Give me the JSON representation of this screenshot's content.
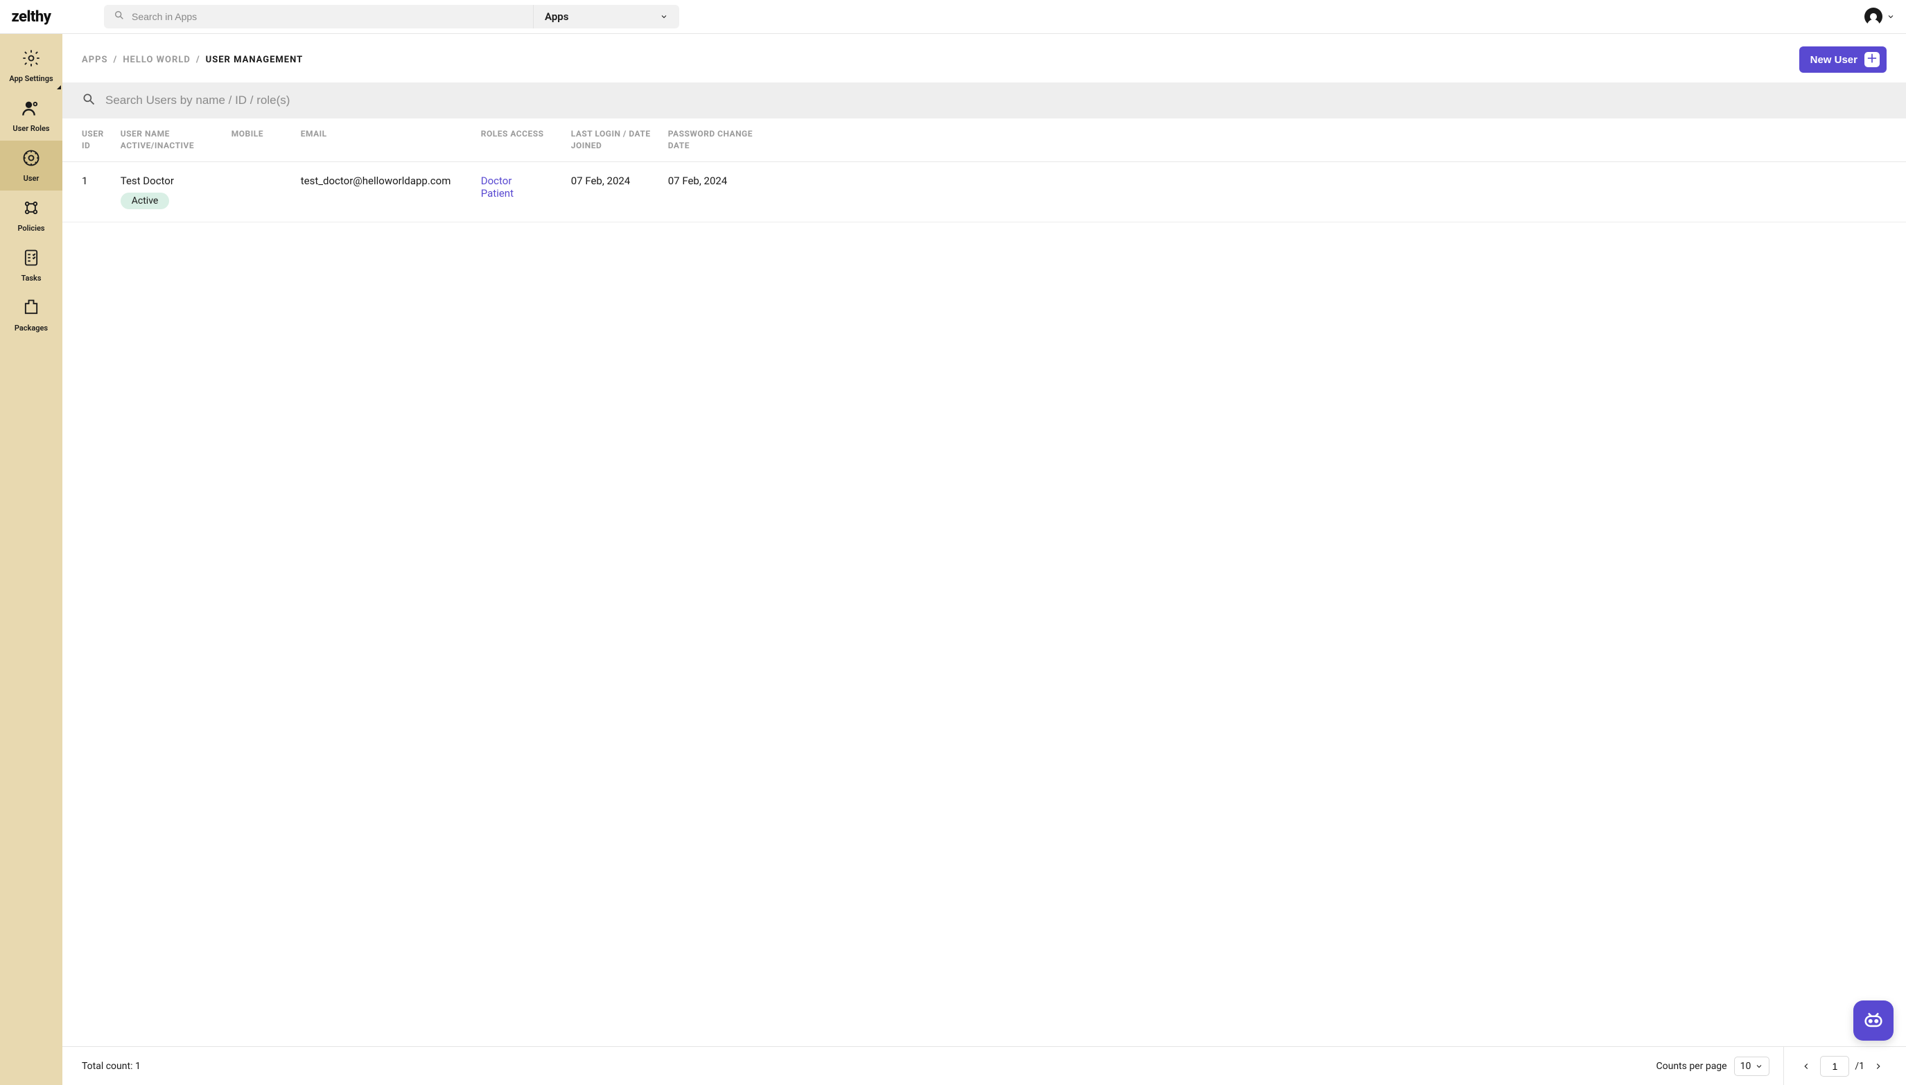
{
  "brand": "zelthy",
  "topbar": {
    "search_placeholder": "Search in Apps",
    "scope_label": "Apps"
  },
  "sidebar": {
    "items": [
      {
        "id": "app-settings",
        "label": "App Settings",
        "has_submenu": true
      },
      {
        "id": "user-roles",
        "label": "User Roles"
      },
      {
        "id": "user",
        "label": "User",
        "active": true
      },
      {
        "id": "policies",
        "label": "Policies"
      },
      {
        "id": "tasks",
        "label": "Tasks"
      },
      {
        "id": "packages",
        "label": "Packages"
      }
    ]
  },
  "breadcrumb": {
    "parts": [
      "APPS",
      "HELLO WORLD",
      "USER MANAGEMENT"
    ],
    "sep": "/"
  },
  "actions": {
    "new_user": "New User"
  },
  "user_search_placeholder": "Search Users by name / ID / role(s)",
  "table": {
    "headers": {
      "user_id": "USER ID",
      "user_name": "USER NAME ACTIVE/INACTIVE",
      "mobile": "MOBILE",
      "email": "EMAIL",
      "roles": "ROLES ACCESS",
      "last_login": "LAST LOGIN / DATE JOINED",
      "pwd_change": "PASSWORD CHANGE DATE"
    },
    "rows": [
      {
        "id": "1",
        "name": "Test Doctor",
        "status": "Active",
        "mobile": "",
        "email": "test_doctor@helloworldapp.com",
        "roles": [
          "Doctor",
          "Patient"
        ],
        "last_login": "07 Feb, 2024",
        "pwd_change": "07 Feb, 2024"
      }
    ]
  },
  "footer": {
    "total_label": "Total count:",
    "total_value": "1",
    "per_page_label": "Counts per page",
    "per_page_value": "10",
    "page_current": "1",
    "page_total": "/1"
  }
}
